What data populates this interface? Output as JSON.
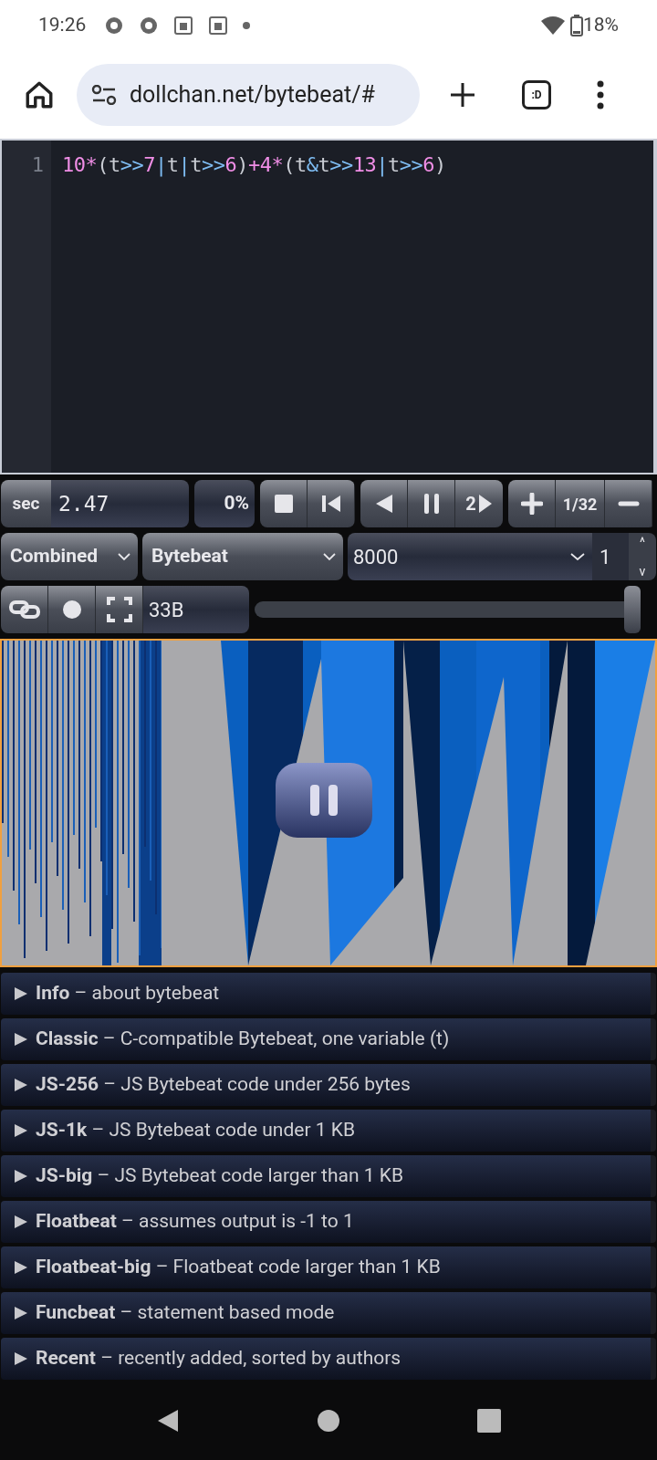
{
  "status_bar": {
    "time": "19:26",
    "battery": "18%"
  },
  "browser": {
    "url": "dollchan.net/bytebeat/#",
    "tab_count": ":D"
  },
  "editor": {
    "line_number": "1",
    "tokens": [
      {
        "text": "10",
        "kind": "number"
      },
      {
        "text": "*",
        "kind": "arith"
      },
      {
        "text": "(t",
        "kind": "plain"
      },
      {
        "text": ">>",
        "kind": "bitwise"
      },
      {
        "text": "7",
        "kind": "number"
      },
      {
        "text": "|",
        "kind": "bitwise"
      },
      {
        "text": "t",
        "kind": "plain"
      },
      {
        "text": "|",
        "kind": "bitwise"
      },
      {
        "text": "t",
        "kind": "plain"
      },
      {
        "text": ">>",
        "kind": "bitwise"
      },
      {
        "text": "6",
        "kind": "number"
      },
      {
        "text": ")",
        "kind": "plain"
      },
      {
        "text": "+",
        "kind": "arith"
      },
      {
        "text": "4",
        "kind": "number"
      },
      {
        "text": "*",
        "kind": "arith"
      },
      {
        "text": "(t",
        "kind": "plain"
      },
      {
        "text": "&",
        "kind": "bitwise"
      },
      {
        "text": "t",
        "kind": "plain"
      },
      {
        "text": ">>",
        "kind": "bitwise"
      },
      {
        "text": "13",
        "kind": "number"
      },
      {
        "text": "|",
        "kind": "bitwise"
      },
      {
        "text": "t",
        "kind": "plain"
      },
      {
        "text": ">>",
        "kind": "bitwise"
      },
      {
        "text": "6",
        "kind": "number"
      },
      {
        "text": ")",
        "kind": "plain"
      }
    ]
  },
  "controls": {
    "time_unit": "sec",
    "time": "2.47",
    "volume": "0%",
    "speed": "2",
    "scale": "1/32",
    "view_mode": "Combined",
    "type": "Bytebeat",
    "sample_rate": "8000",
    "divisor": "1",
    "stepper_up": "^",
    "stepper_down": "v",
    "code_size": "33B",
    "seek": {
      "level": 0.98
    }
  },
  "library": [
    {
      "name": "Info",
      "description": "– about bytebeat"
    },
    {
      "name": "Classic",
      "description": "– C-compatible Bytebeat, one variable (t)"
    },
    {
      "name": "JS-256",
      "description": "– JS Bytebeat code under 256 bytes"
    },
    {
      "name": "JS-1k",
      "description": "– JS Bytebeat code under 1 KB"
    },
    {
      "name": "JS-big",
      "description": "– JS Bytebeat code larger than 1 KB"
    },
    {
      "name": "Floatbeat",
      "description": "– assumes output is -1 to 1"
    },
    {
      "name": "Floatbeat-big",
      "description": "– Floatbeat code larger than 1 KB"
    },
    {
      "name": "Funcbeat",
      "description": "– statement based mode"
    },
    {
      "name": "Recent",
      "description": "– recently added, sorted by authors"
    }
  ]
}
